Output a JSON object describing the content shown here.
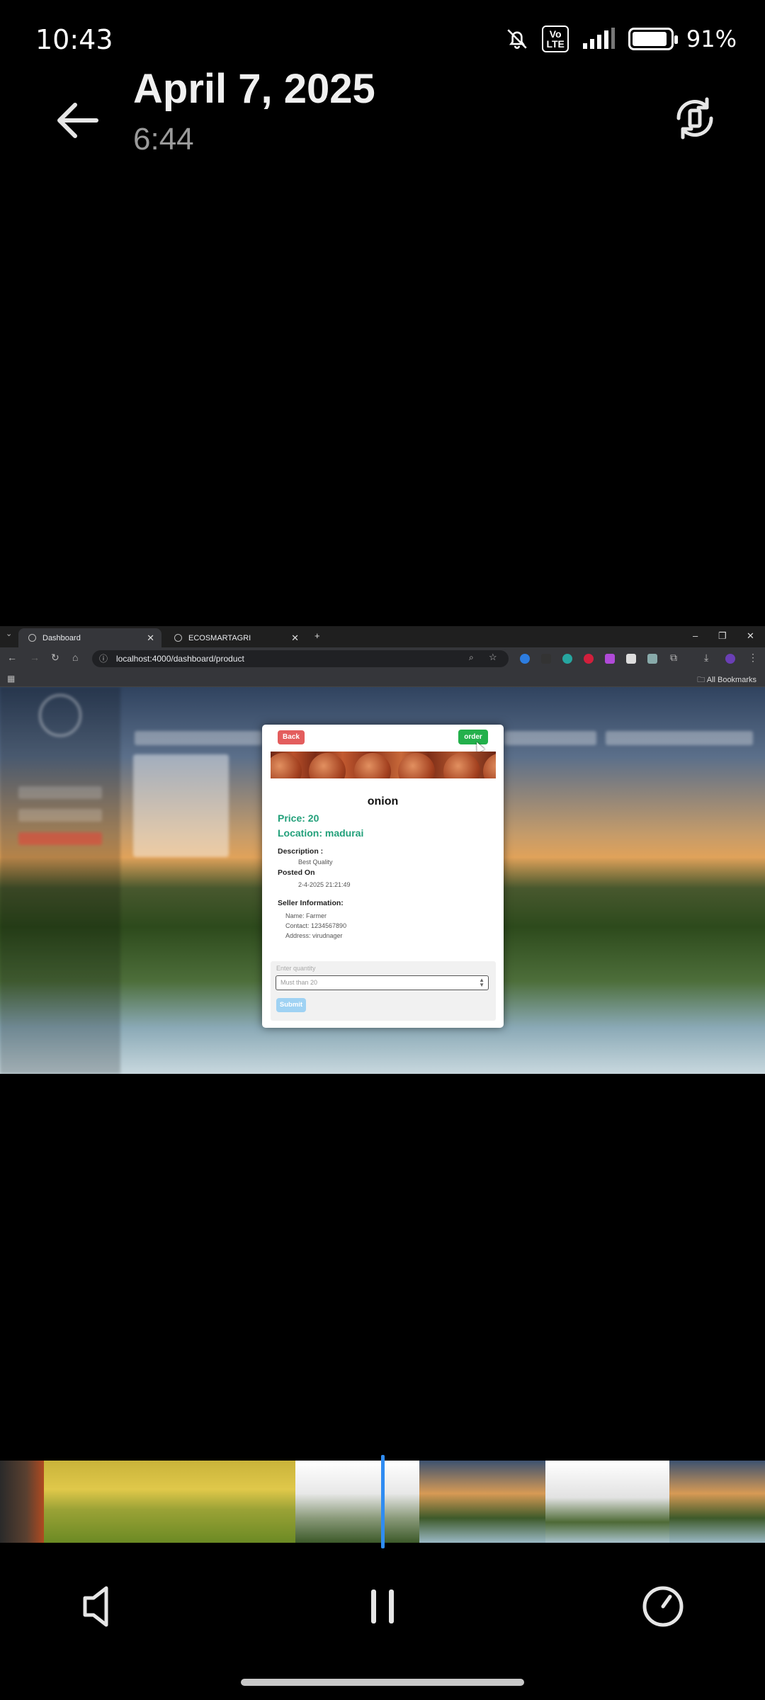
{
  "status_bar": {
    "time": "10:43",
    "volte": "Vo\nLTE",
    "battery_percent": "91%",
    "battery_level": 0.91
  },
  "header": {
    "date": "April 7, 2025",
    "duration": "6:44"
  },
  "browser": {
    "tabs": [
      {
        "label": "Dashboard"
      },
      {
        "label": "ECOSMARTAGRI"
      }
    ],
    "new_tab": "+",
    "url": "localhost:4000/dashboard/product",
    "all_bookmarks": "All Bookmarks"
  },
  "modal": {
    "back_label": "Back",
    "order_label": "order",
    "product_name": "onion",
    "price": "Price: 20",
    "location": "Location: madurai",
    "description_label": "Description :",
    "description_value": "Best Quality",
    "posted_label": "Posted On",
    "posted_value": "2-4-2025 21:21:49",
    "seller_label": "Seller Information:",
    "seller_name": "Name: Farmer",
    "seller_contact": "Contact: 1234567890",
    "seller_address": "Address: virudnager",
    "quantity_label": "Enter quantity",
    "quantity_placeholder": "Must than 20",
    "submit_label": "Submit"
  },
  "colors": {
    "order": "#23b04b",
    "back": "#e35d5d",
    "accent_text": "#22a07a",
    "playhead": "#2f8cf2"
  },
  "playback": {
    "state": "playing"
  }
}
